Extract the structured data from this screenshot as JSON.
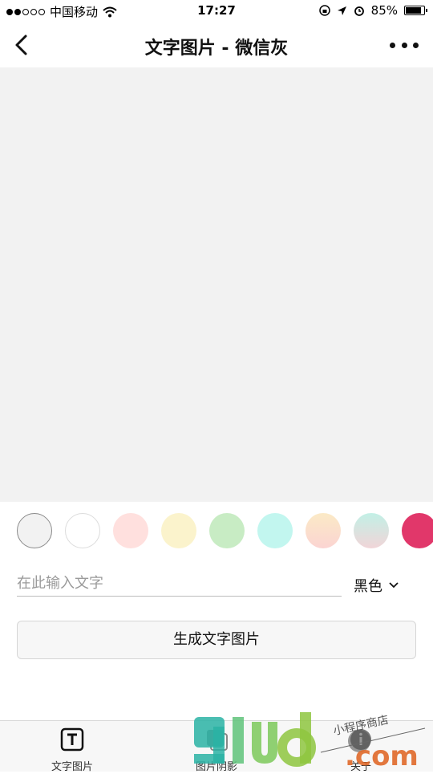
{
  "status_bar": {
    "carrier": "中国移动",
    "time": "17:27",
    "battery": "85%",
    "battery_level": 0.85
  },
  "nav": {
    "title": "文字图片 - 微信灰",
    "back_icon": "chevron-left-icon",
    "more_icon": "more-dots-icon"
  },
  "preview": {
    "background": "#f2f2f2"
  },
  "swatches": [
    {
      "name": "wechat-gray",
      "color": "#f2f2f2",
      "border": "#8a8a8a",
      "selected": true
    },
    {
      "name": "white",
      "color": "#ffffff",
      "border": "#dcdcdc"
    },
    {
      "name": "pink",
      "color": "#ffe0de"
    },
    {
      "name": "cream",
      "color": "#fbf3cc"
    },
    {
      "name": "green",
      "color": "#c8ecc4"
    },
    {
      "name": "cyan",
      "color": "#c2f6ef"
    },
    {
      "name": "peach-gradient",
      "color": "linear-gradient(#fbeac6, #fbd4d2)"
    },
    {
      "name": "mint-gradient",
      "color": "linear-gradient(#c2f0e6, #f1d5d8)"
    },
    {
      "name": "raspberry",
      "color": "#e1376a"
    }
  ],
  "input": {
    "placeholder": "在此输入文字",
    "value": ""
  },
  "text_color_select": {
    "value": "黑色",
    "icon": "chevron-down-icon"
  },
  "generate_button": {
    "label": "生成文字图片"
  },
  "tabbar": {
    "tabs": [
      {
        "label": "文字图片",
        "icon": "text-t-icon"
      },
      {
        "label": "图片阴影",
        "icon": "image-shadow-icon"
      },
      {
        "label": "关于",
        "icon": "about-icon"
      }
    ]
  },
  "watermark": {
    "brand": "9iud",
    "suffix": ".com",
    "tagline": "小程序商店"
  }
}
